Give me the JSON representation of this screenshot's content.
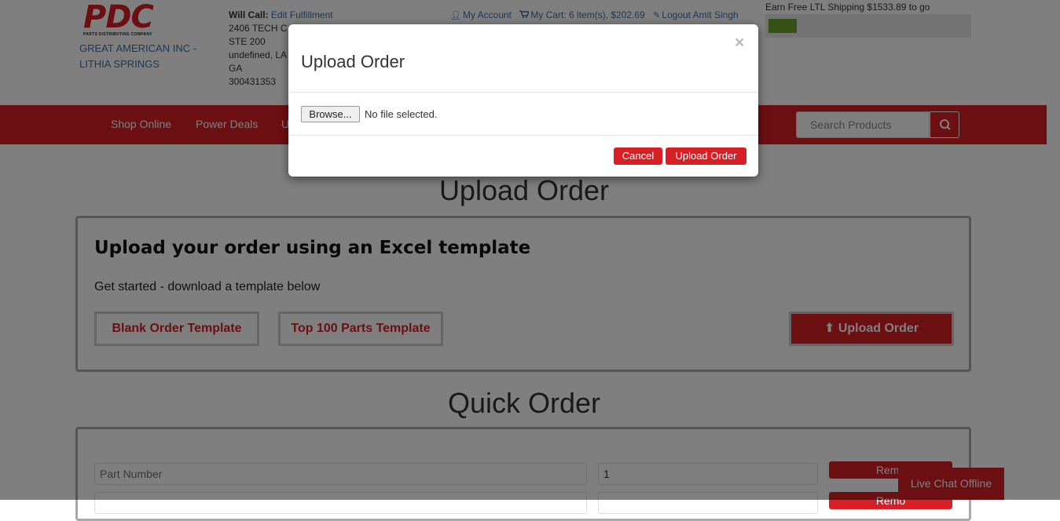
{
  "brand": {
    "logo_text": "PDC",
    "logo_tagline": "PARTS DISTRIBUTING COMPANY",
    "company_line1": "GREAT AMERICAN INC -",
    "company_line2": "LITHIA SPRINGS",
    "accent_color": "#d91f26"
  },
  "will_call": {
    "label": "Will Call:",
    "edit_link": "Edit Fulfillment",
    "address_line1": "2406 TECH C",
    "address_line2": "STE 200",
    "address_line3": "undefined, LA",
    "address_line4": "GA",
    "address_line5": "300431353"
  },
  "top_links": {
    "account": "My Account",
    "cart": "My Cart: 6 item(s), $202.69",
    "logout": "Logout Amit Singh",
    "account_icon": "user-icon",
    "cart_icon": "cart-icon",
    "logout_icon": "pencil-icon"
  },
  "shipping": {
    "text": "Earn Free LTL Shipping $1533.89 to go",
    "progress_fraction": 0.14,
    "bar_color": "#6aa22c"
  },
  "nav": {
    "items": [
      "Shop Online",
      "Power Deals",
      "U"
    ],
    "search_placeholder": "Search Products",
    "search_icon": "search-icon"
  },
  "main": {
    "upload_heading": "Upload Order",
    "panel_title": "Upload your order using an Excel template",
    "panel_subtitle": "Get started - download a template below",
    "blank_template": "Blank Order Template",
    "top100_template": "Top 100 Parts Template",
    "upload_button": "Upload Order",
    "upload_icon": "arrow-up-icon",
    "quick_heading": "Quick Order",
    "part_number_placeholder": "Part Number",
    "quantity_value": "1",
    "remove_button": "Remo"
  },
  "chat": {
    "label": "Live Chat Offline"
  },
  "modal": {
    "title": "Upload Order",
    "close": "×",
    "browse": "Browse...",
    "no_file": "No file selected.",
    "cancel": "Cancel",
    "upload": "Upload Order"
  }
}
